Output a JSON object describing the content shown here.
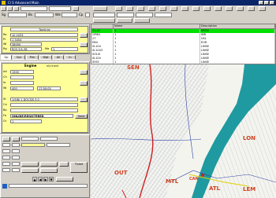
{
  "window": {
    "title": "Cl S   Advanced   Main"
  },
  "toolbar": {
    "labels": [
      "Sg",
      "Bs",
      "Wd",
      "Cp"
    ]
  },
  "upper_form": {
    "title": "Tomlinle",
    "labels": [
      "Ro",
      "Pr",
      "Wi",
      "Rg",
      "Ma"
    ],
    "values": [
      "10 1033",
      "1 3454",
      "38090",
      "R05-3/4-38",
      "1"
    ]
  },
  "tabs": [
    "Gp",
    "Opr",
    "Prm",
    "Wgt",
    "All",
    "In"
  ],
  "engine": {
    "label": "Engine",
    "sub": "nly Incid"
  },
  "lower_form": {
    "labels": [
      "Ad",
      "Ch",
      "Io",
      "Wi",
      "St",
      "Ca",
      "Bo",
      "Fo",
      "Gr"
    ],
    "values": [
      "1500",
      "400",
      "17:00:05",
      "1/9/8/ 1 DOCSIS 3.0",
      "ONLINE/REGISTERED",
      "1"
    ],
    "send_label": "Send"
  },
  "ticket_button": "Ticket",
  "arrow_buttons": [
    "▲",
    "◀",
    "▶",
    "▼"
  ],
  "table": {
    "columns": [
      "",
      "Name",
      "Description"
    ],
    "rows": [
      [
        "31:47",
        "1",
        "ERTW"
      ],
      [
        "GPW1",
        "1",
        "INR"
      ],
      [
        "27",
        "1",
        "USL"
      ],
      [
        "EB4",
        "1",
        "EUR"
      ],
      [
        "0L104",
        "1",
        "LINSE"
      ],
      [
        "0L1043",
        "1",
        "LINSE"
      ],
      [
        "SOLI0",
        "1",
        "LINSE"
      ],
      [
        "0L104",
        "1",
        "LINSE"
      ],
      [
        "SIYIS",
        "1",
        "LINSE"
      ]
    ]
  },
  "map": {
    "labels": [
      "SEN",
      "LON",
      "OUT",
      "ATL",
      "MTL",
      "LEM",
      "CAN"
    ]
  }
}
